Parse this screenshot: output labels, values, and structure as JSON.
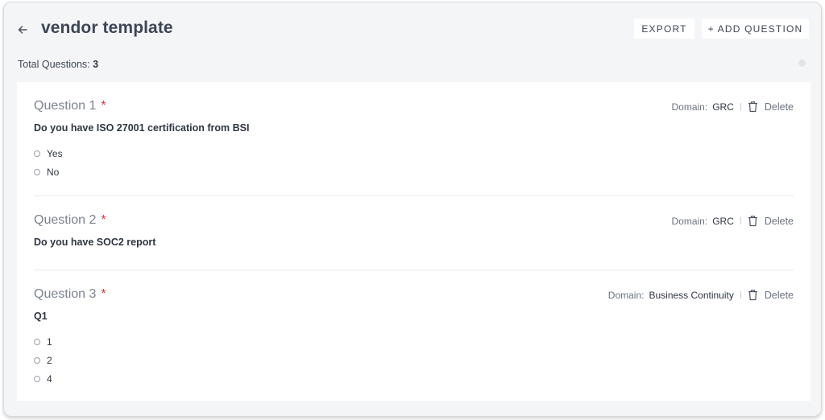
{
  "header": {
    "title": "vendor template",
    "export_label": "EXPORT",
    "add_question_label": "+ ADD QUESTION"
  },
  "summary": {
    "total_label": "Total Questions:",
    "total_count": "3"
  },
  "questions": [
    {
      "label": "Question 1",
      "required_mark": "*",
      "domain_label": "Domain:",
      "domain": "GRC",
      "delete_label": "Delete",
      "text": "Do you have ISO 27001 certification from BSI",
      "options": [
        "Yes",
        "No"
      ]
    },
    {
      "label": "Question 2",
      "required_mark": "*",
      "domain_label": "Domain:",
      "domain": "GRC",
      "delete_label": "Delete",
      "text": "Do you have SOC2 report",
      "options": []
    },
    {
      "label": "Question 3",
      "required_mark": "*",
      "domain_label": "Domain:",
      "domain": "Business Continuity",
      "delete_label": "Delete",
      "text": "Q1",
      "options": [
        "1",
        "2",
        "4"
      ]
    }
  ],
  "icons": {
    "back": "arrow-left-icon",
    "delete": "trash-icon",
    "option": "radio-circle-icon"
  },
  "colors": {
    "background": "#f4f5f7",
    "required": "#d83a3a",
    "title": "#3d4656"
  }
}
